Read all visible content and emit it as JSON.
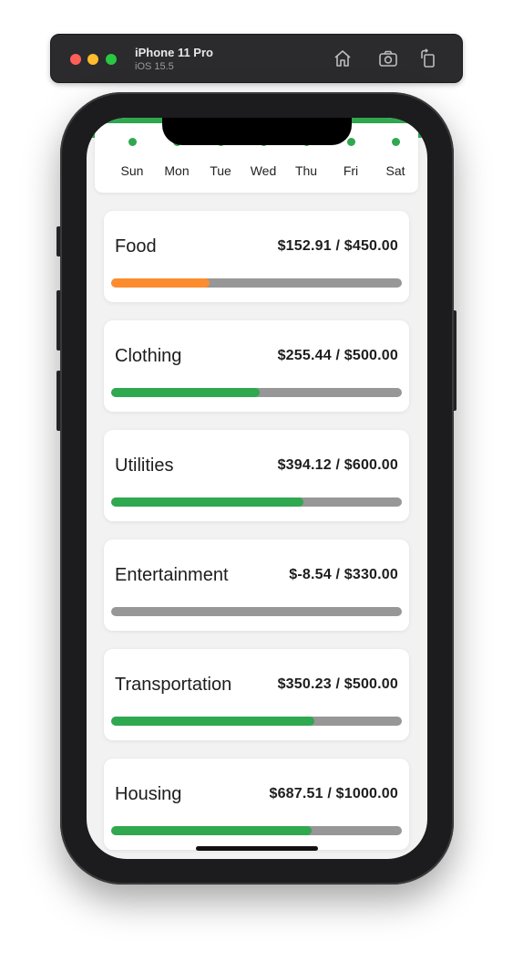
{
  "simulator": {
    "device_name": "iPhone 11 Pro",
    "os_version": "iOS 15.5"
  },
  "colors": {
    "accent_green": "#2fa84f",
    "warning_orange": "#fd8c2e",
    "track_gray": "#979797"
  },
  "week": {
    "days": [
      "Sun",
      "Mon",
      "Tue",
      "Wed",
      "Thu",
      "Fri",
      "Sat"
    ]
  },
  "categories": [
    {
      "name": "Food",
      "amount": "$152.91 / $450.00",
      "progress": 0.34,
      "color": "#fd8c2e"
    },
    {
      "name": "Clothing",
      "amount": "$255.44 / $500.00",
      "progress": 0.51,
      "color": "#2fa84f"
    },
    {
      "name": "Utilities",
      "amount": "$394.12 / $600.00",
      "progress": 0.66,
      "color": "#2fa84f"
    },
    {
      "name": "Entertainment",
      "amount": "$-8.54 / $330.00",
      "progress": 0.0,
      "color": "#2fa84f"
    },
    {
      "name": "Transportation",
      "amount": "$350.23 / $500.00",
      "progress": 0.7,
      "color": "#2fa84f"
    },
    {
      "name": "Housing",
      "amount": "$687.51 / $1000.00",
      "progress": 0.69,
      "color": "#2fa84f"
    }
  ]
}
